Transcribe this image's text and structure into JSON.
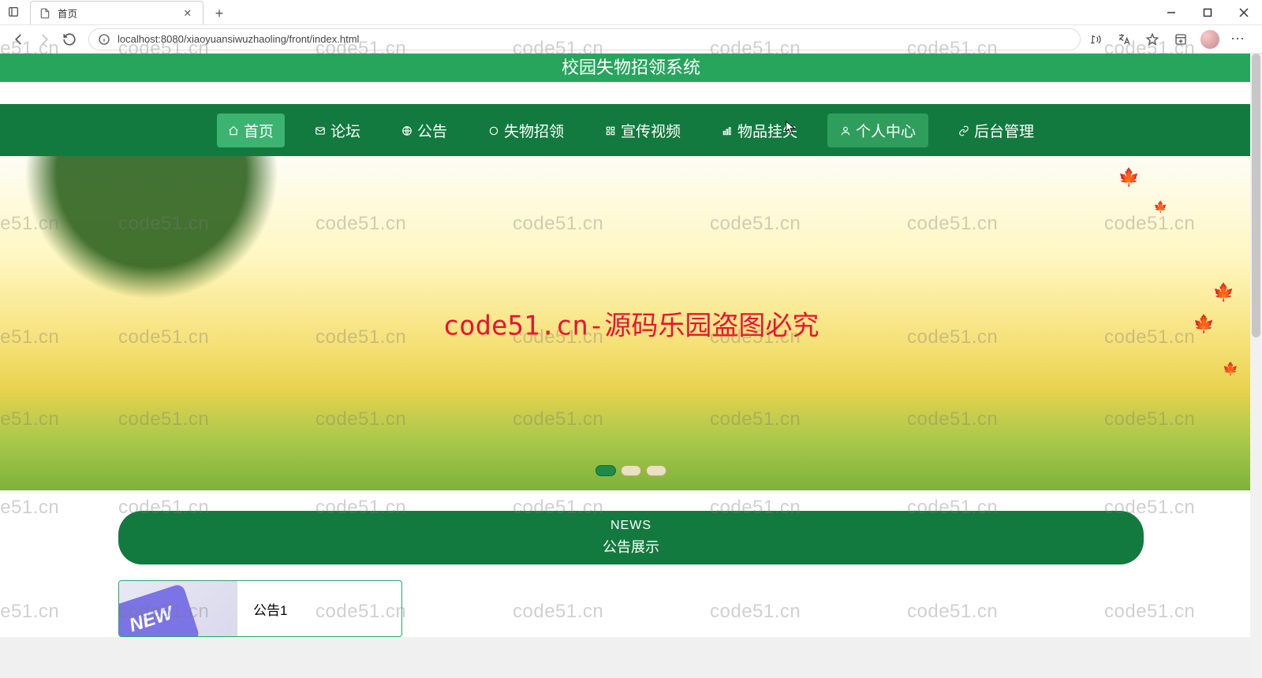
{
  "browser": {
    "tab_title": "首页",
    "url": "localhost:8080/xiaoyuansiwuzhaoling/front/index.html"
  },
  "site": {
    "title": "校园失物招领系统"
  },
  "nav": {
    "items": [
      {
        "label": "首页",
        "active": true,
        "icon": "home"
      },
      {
        "label": "论坛",
        "active": false,
        "icon": "mail"
      },
      {
        "label": "公告",
        "active": false,
        "icon": "globe"
      },
      {
        "label": "失物招领",
        "active": false,
        "icon": "circle"
      },
      {
        "label": "宣传视频",
        "active": false,
        "icon": "grid"
      },
      {
        "label": "物品挂失",
        "active": false,
        "icon": "bars"
      },
      {
        "label": "个人中心",
        "active": false,
        "icon": "user",
        "hover": true
      },
      {
        "label": "后台管理",
        "active": false,
        "icon": "link"
      }
    ]
  },
  "banner": {
    "overlay_text": "code51.cn-源码乐园盗图必究",
    "dot_count": 3,
    "active_dot": 0
  },
  "news": {
    "header_en": "NEWS",
    "header_cn": "公告展示",
    "items": [
      {
        "title": "公告1",
        "badge": "NEW"
      }
    ]
  },
  "watermark": "code51.cn"
}
